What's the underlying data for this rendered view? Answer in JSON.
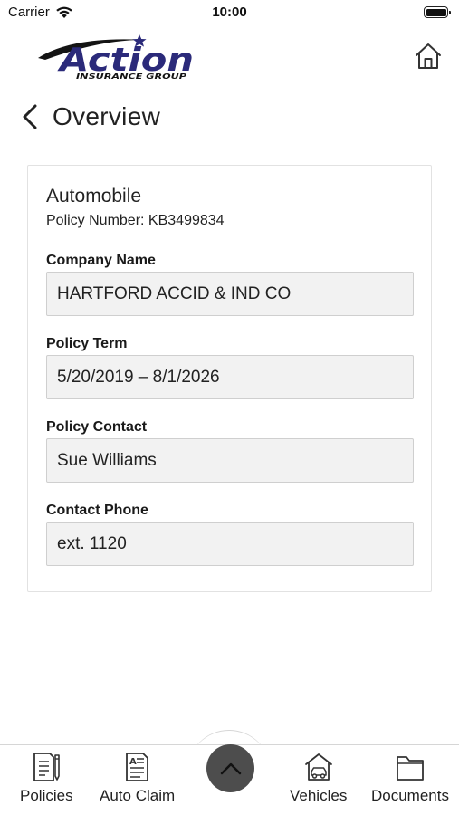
{
  "status_bar": {
    "carrier": "Carrier",
    "time": "10:00"
  },
  "header": {
    "logo": {
      "name": "Action",
      "subtitle": "INSURANCE GROUP",
      "brand_color": "#2b2a7a"
    },
    "home_icon": "home-icon"
  },
  "page": {
    "title": "Overview",
    "back_icon": "chevron-left-icon"
  },
  "policy": {
    "type": "Automobile",
    "number_line": "Policy Number: KB3499834",
    "fields": [
      {
        "label": "Company Name",
        "value": "HARTFORD ACCID & IND CO"
      },
      {
        "label": "Policy Term",
        "value": "5/20/2019 – 8/1/2026"
      },
      {
        "label": "Policy Contact",
        "value": "Sue Williams"
      },
      {
        "label": "Contact Phone",
        "value": "ext. 1120"
      }
    ]
  },
  "tab_bar": {
    "tabs": [
      {
        "label": "Policies",
        "icon": "policies-icon"
      },
      {
        "label": "Auto Claim",
        "icon": "auto-claim-icon"
      },
      {
        "label": "Vehicles",
        "icon": "vehicles-icon"
      },
      {
        "label": "Documents",
        "icon": "documents-icon"
      }
    ],
    "center_icon": "chevron-up-icon",
    "center_color": "#4d4d4d"
  }
}
